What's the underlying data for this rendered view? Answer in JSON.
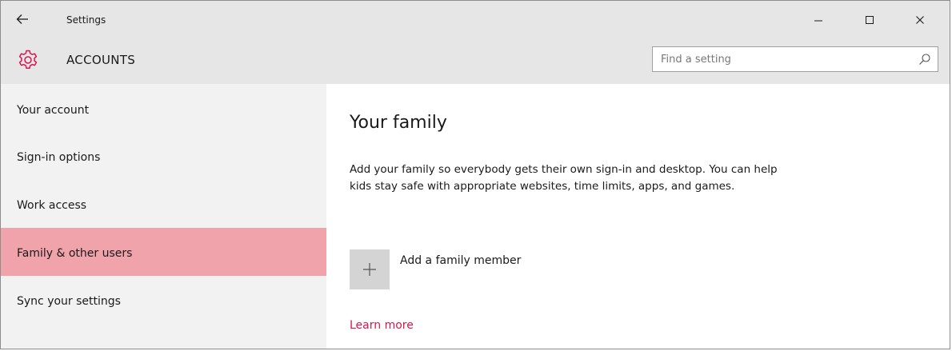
{
  "window": {
    "title": "Settings",
    "controls": [
      "minimize",
      "maximize",
      "close"
    ]
  },
  "header": {
    "app_name": "ACCOUNTS",
    "app_icon": "gear-icon",
    "search": {
      "placeholder": "Find a setting",
      "value": ""
    }
  },
  "sidebar": {
    "items": [
      {
        "label": "Your account",
        "selected": false
      },
      {
        "label": "Sign-in options",
        "selected": false
      },
      {
        "label": "Work access",
        "selected": false
      },
      {
        "label": "Family & other users",
        "selected": true
      },
      {
        "label": "Sync your settings",
        "selected": false
      }
    ]
  },
  "main": {
    "title": "Your family",
    "description": "Add your family so everybody gets their own sign-in and desktop. You can help kids stay safe with appropriate websites, time limits, apps, and games.",
    "add_member_label": "Add a family member",
    "learn_more_label": "Learn more"
  },
  "colors": {
    "accent": "#d6164f",
    "selected_nav": "#f0a3ab",
    "header_bg": "#e6e6e6",
    "sidebar_bg": "#f2f2f2"
  }
}
